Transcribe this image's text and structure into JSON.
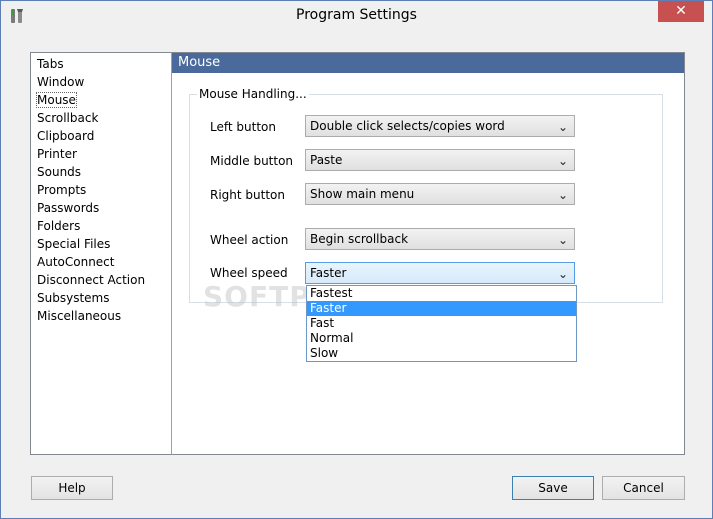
{
  "window": {
    "title": "Program Settings",
    "close_glyph": "✕"
  },
  "nav": {
    "items": [
      {
        "label": "Tabs"
      },
      {
        "label": "Window"
      },
      {
        "label": "Mouse"
      },
      {
        "label": "Scrollback"
      },
      {
        "label": "Clipboard"
      },
      {
        "label": "Printer"
      },
      {
        "label": "Sounds"
      },
      {
        "label": "Prompts"
      },
      {
        "label": "Passwords"
      },
      {
        "label": "Folders"
      },
      {
        "label": "Special Files"
      },
      {
        "label": "AutoConnect"
      },
      {
        "label": "Disconnect Action"
      },
      {
        "label": "Subsystems"
      },
      {
        "label": "Miscellaneous"
      }
    ],
    "selected": "Mouse"
  },
  "content": {
    "header": "Mouse",
    "group_label": "Mouse Handling...",
    "fields": {
      "left_button": {
        "label": "Left button",
        "value": "Double click selects/copies word"
      },
      "middle_button": {
        "label": "Middle button",
        "value": "Paste"
      },
      "right_button": {
        "label": "Right button",
        "value": "Show main menu"
      },
      "wheel_action": {
        "label": "Wheel action",
        "value": "Begin scrollback"
      },
      "wheel_speed": {
        "label": "Wheel speed",
        "value": "Faster"
      }
    },
    "wheel_speed_options": [
      "Fastest",
      "Faster",
      "Fast",
      "Normal",
      "Slow"
    ],
    "highlighted_option": "Faster"
  },
  "watermark": "SOFTPEDIA",
  "buttons": {
    "help": "Help",
    "save": "Save",
    "cancel": "Cancel"
  },
  "colors": {
    "header_bg": "#4a6a9c",
    "highlight": "#3399ff",
    "close_bg": "#c75050"
  },
  "icons": {
    "app": "tools-icon",
    "combo_arrow": "chevron-down-icon"
  }
}
